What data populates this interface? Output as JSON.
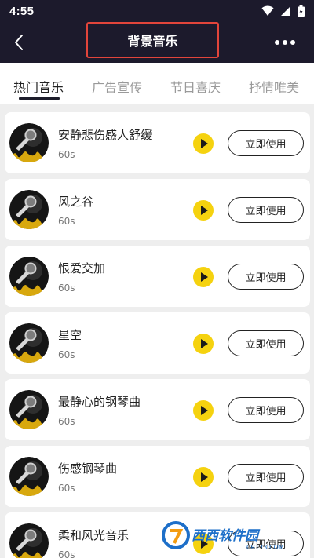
{
  "status_bar": {
    "time": "4:55",
    "icons": [
      "wifi-icon",
      "signal-icon",
      "battery-icon"
    ]
  },
  "header": {
    "title": "背景音乐",
    "back_icon": "back-arrow-icon",
    "more_icon": "more-icon"
  },
  "tabs": [
    {
      "label": "热门音乐",
      "active": true
    },
    {
      "label": "广告宣传",
      "active": false
    },
    {
      "label": "节日喜庆",
      "active": false
    },
    {
      "label": "抒情唯美",
      "active": false
    }
  ],
  "songs": [
    {
      "title": "安静悲伤感人舒缓",
      "duration": "60s",
      "action": "立即使用"
    },
    {
      "title": "风之谷",
      "duration": "60s",
      "action": "立即使用"
    },
    {
      "title": "恨爱交加",
      "duration": "60s",
      "action": "立即使用"
    },
    {
      "title": "星空",
      "duration": "60s",
      "action": "立即使用"
    },
    {
      "title": "最静心的钢琴曲",
      "duration": "60s",
      "action": "立即使用"
    },
    {
      "title": "伤感钢琴曲",
      "duration": "60s",
      "action": "立即使用"
    },
    {
      "title": "柔和风光音乐",
      "duration": "60s",
      "action": "立即使用"
    }
  ],
  "watermark": {
    "text": "西西软件园",
    "domain": "CR173.COM"
  },
  "colors": {
    "header_bg": "#1c1a2c",
    "accent_yellow": "#f5d20f",
    "title_outline": "#e2453b"
  }
}
